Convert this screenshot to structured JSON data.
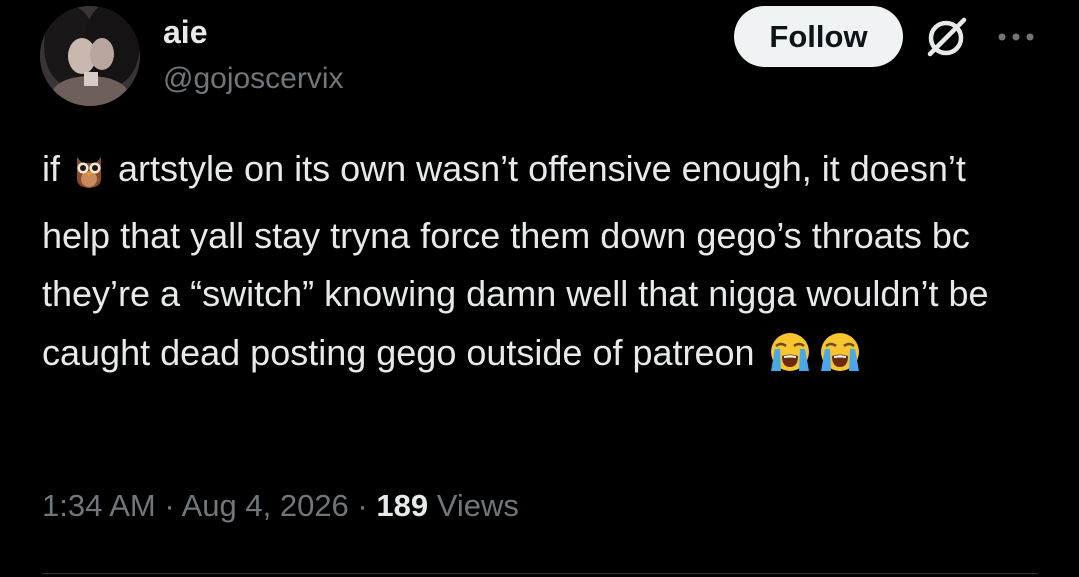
{
  "author": {
    "display_name": "aie",
    "handle": "@gojoscervix"
  },
  "header": {
    "follow_label": "Follow",
    "grok_icon": "grok-icon",
    "more_icon": "more-icon"
  },
  "tweet": {
    "text_part1": "if ",
    "text_part2": " artstyle on its own wasn’t offensive enough, it doesn’t help that yall stay tryna force them down gego’s throats bc they’re a “switch” knowing damn well that nigga wouldn’t be caught dead posting gego outside of patreon ",
    "emojis": [
      "owl-emoji",
      "loudly-crying-face-emoji",
      "loudly-crying-face-emoji"
    ]
  },
  "meta": {
    "time": "1:34 AM",
    "separator": " · ",
    "date": "Aug 4, 2026",
    "views_count": "189",
    "views_label": " Views"
  },
  "colors": {
    "background": "#000000",
    "text": "#e7e9ea",
    "secondary": "#71767b",
    "follow_bg": "#eff3f4"
  }
}
